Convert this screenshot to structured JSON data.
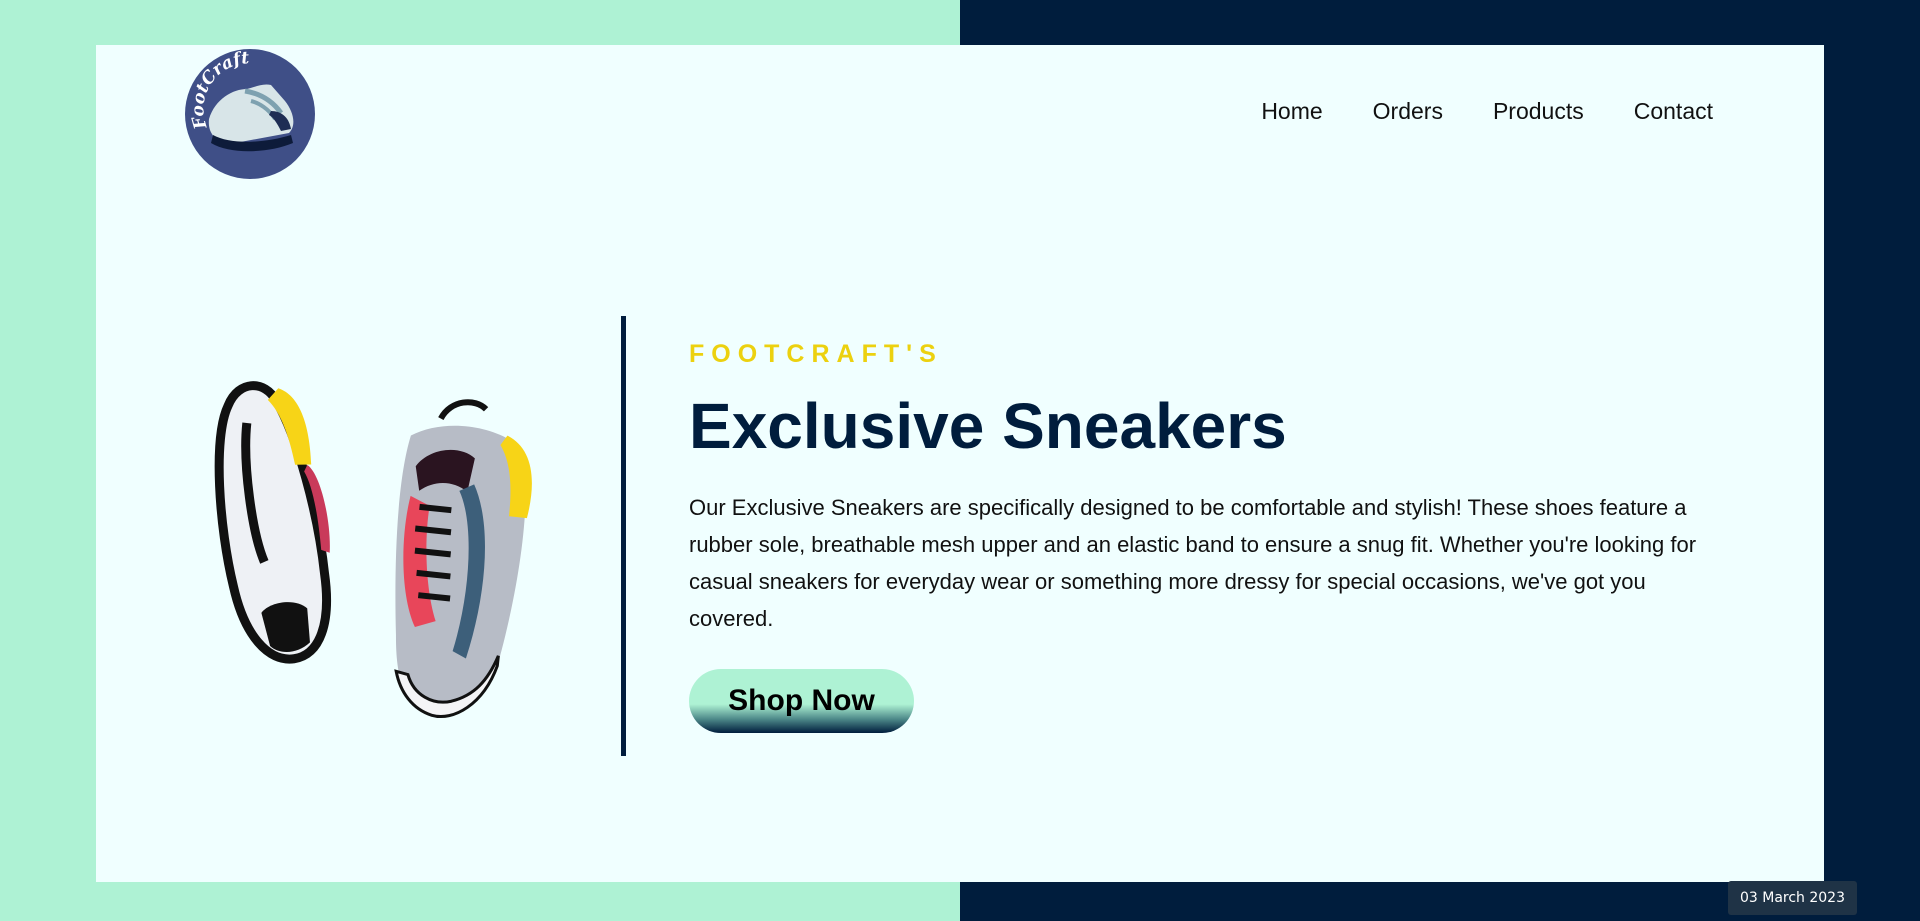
{
  "brand": {
    "logo_text": "FootCraft",
    "logo_icon": "sneaker-logo-icon"
  },
  "nav": {
    "items": [
      {
        "label": "Home"
      },
      {
        "label": "Orders"
      },
      {
        "label": "Products"
      },
      {
        "label": "Contact"
      }
    ]
  },
  "hero": {
    "eyebrow": "FOOTCRAFT'S",
    "title": "Exclusive Sneakers",
    "description": "Our Exclusive Sneakers are specifically designed to be comfortable and stylish! These shoes feature a rubber sole, breathable mesh upper and an elastic band to ensure a snug fit. Whether you're looking for casual sneakers for everyday wear or something more dressy for special occasions, we've got you covered.",
    "cta_label": "Shop Now",
    "image_icon": "sneakers-pair-image"
  },
  "taskbar": {
    "date": "03 March 2023"
  },
  "colors": {
    "mint": "#aef2d4",
    "navy": "#001d3d",
    "card": "#f0ffff",
    "accent_yellow": "#ecd10f"
  }
}
